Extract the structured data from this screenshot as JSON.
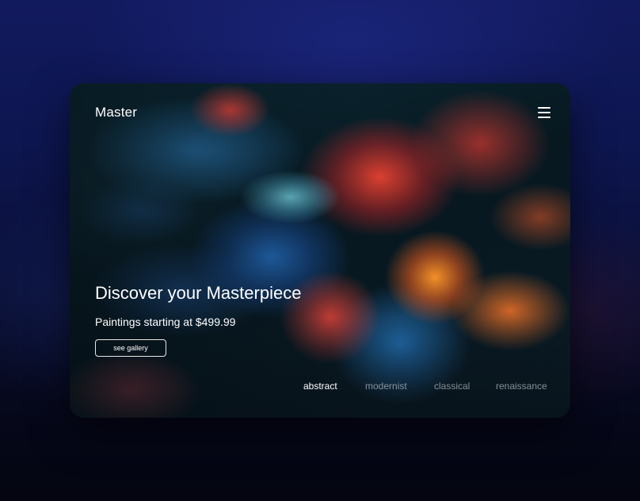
{
  "header": {
    "brand": "Master",
    "menu_icon": "hamburger-menu-icon"
  },
  "hero": {
    "title": "Discover your Masterpiece",
    "subtitle": "Paintings starting at $499.99",
    "cta_label": "see gallery"
  },
  "categories": {
    "tabs": [
      {
        "label": "abstract",
        "active": true
      },
      {
        "label": "modernist",
        "active": false
      },
      {
        "label": "classical",
        "active": false
      },
      {
        "label": "renaissance",
        "active": false
      }
    ]
  },
  "colors": {
    "page_background": "#0d1650",
    "text": "#ffffff",
    "inactive_tab": "#b4b9c4"
  }
}
